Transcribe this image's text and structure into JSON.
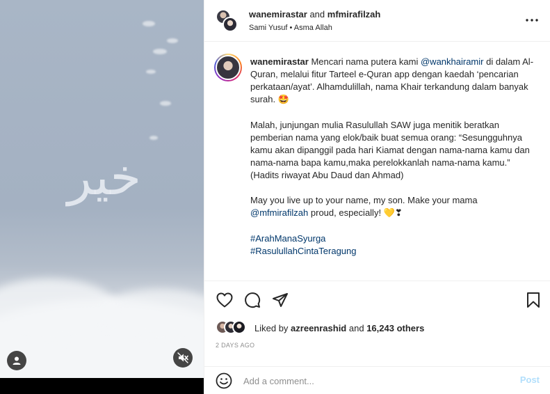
{
  "media": {
    "overlay_text": "خير",
    "user_tag_icon": "person-icon",
    "mute_icon": "speaker-muted-icon"
  },
  "header": {
    "author": "wanemirastar",
    "conjunction": "and",
    "collaborator": "mfmirafilzah",
    "audio": "Sami Yusuf • Asma Allah",
    "more_icon": "•••"
  },
  "caption": {
    "username": "wanemirastar",
    "para1_a": "Mencari nama putera kami",
    "mention1": "@wankhairamir",
    "para1_b": "di dalam Al-Quran, melalui fitur Tarteel e-Quran app dengan kaedah ‘pencarian perkataan/ayat’. Alhamdulillah, nama Khair terkandung dalam banyak surah.",
    "para1_emoji": "🤩",
    "para2": "Malah, junjungan mulia Rasulullah SAW juga menitik beratkan pemberian nama yang elok/baik buat semua orang: “Sesungguhnya kamu akan dipanggil pada hari Kiamat dengan nama-nama kamu dan nama-nama bapa kamu,maka perelokkanlah nama-nama kamu.” (Hadits riwayat Abu Daud dan Ahmad)",
    "para3_a": "May you live up to your name, my son. Make your mama",
    "mention2": "@mfmirafilzah",
    "para3_b": "proud, especially!",
    "para3_emoji": "💛❣",
    "hashtag1": "#ArahManaSyurga",
    "hashtag2": "#RasulullahCintaTeragung"
  },
  "likes": {
    "prefix": "Liked by",
    "first_liker": "azreenrashid",
    "joiner": "and",
    "others": "16,243 others"
  },
  "timestamp": "2 DAYS AGO",
  "add_comment": {
    "placeholder": "Add a comment...",
    "post_label": "Post"
  },
  "colors": {
    "link": "#00376b",
    "post_disabled": "#b2dffc",
    "meta_gray": "#8e8e8e"
  }
}
